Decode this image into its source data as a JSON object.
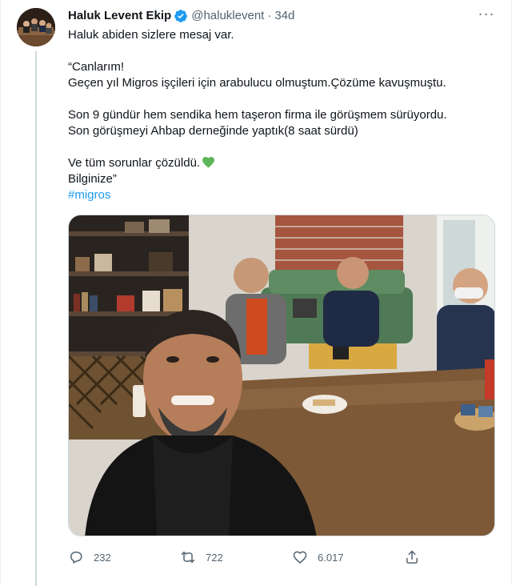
{
  "tweet": {
    "author_name": "Haluk Levent Ekip",
    "handle": "@haluklevent",
    "separator": "·",
    "time": "34d",
    "more_label": "···",
    "lines": [
      "Haluk abiden sizlere mesaj var.",
      "",
      "“Canlarım!",
      "Geçen yıl Migros işçileri için arabulucu olmuştum.Çözüme kavuşmuştu.",
      "",
      "Son 9 gündür hem sendika hem taşeron firma ile görüşmem sürüyordu.",
      "Son görüşmeyi Ahbap derneğinde yaptık(8 saat sürdü)",
      "",
      "Ve tüm sorunlar çözüldü.",
      "Bilginize”"
    ],
    "hashtag": "#migros",
    "emoji": "green-heart-emoji"
  },
  "actions": {
    "reply_count": "232",
    "retweet_count": "722",
    "like_count": "6.017"
  },
  "icons": {
    "verified": "verified-badge-icon",
    "reply": "reply-icon",
    "retweet": "retweet-icon",
    "like": "heart-icon",
    "share": "share-icon"
  },
  "colors": {
    "accent": "#1d9bf0",
    "text": "#0f1419",
    "muted": "#536471",
    "emoji_heart": "#5fb55a"
  }
}
